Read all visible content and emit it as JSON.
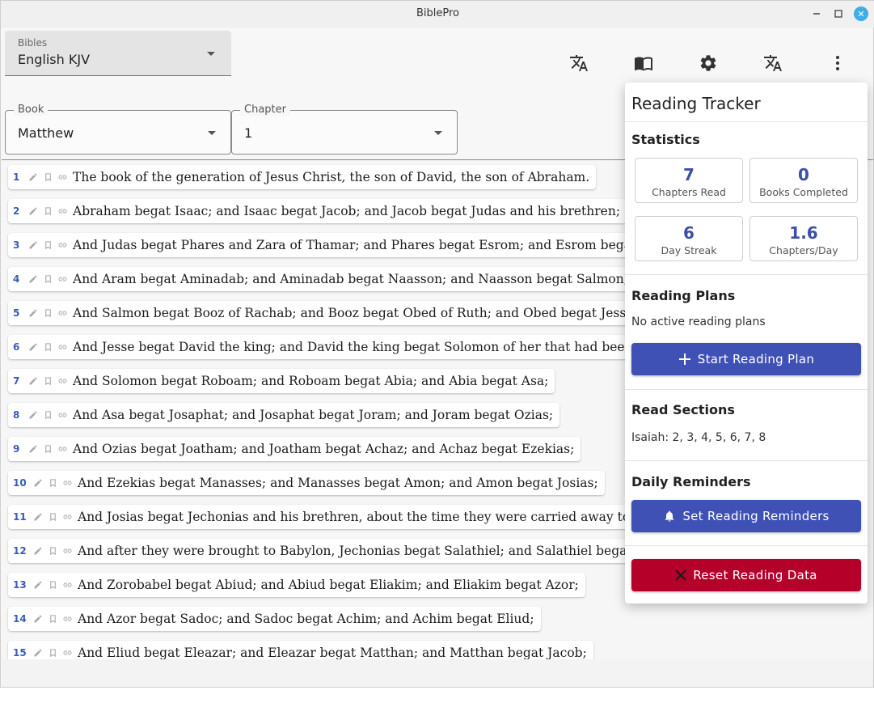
{
  "window": {
    "title": "BiblePro"
  },
  "bibles": {
    "label": "Bibles",
    "value": "English KJV"
  },
  "toolbar": {
    "icons": [
      "translate-icon",
      "book-open-icon",
      "settings-icon",
      "translate-icon",
      "more-vert-icon"
    ]
  },
  "book": {
    "label": "Book",
    "value": "Matthew"
  },
  "chapter": {
    "label": "Chapter",
    "value": "1"
  },
  "verses": [
    {
      "num": "1",
      "text": "The book of the generation of Jesus Christ, the son of David, the son of Abraham."
    },
    {
      "num": "2",
      "text": "Abraham begat Isaac; and Isaac begat Jacob; and Jacob begat Judas and his brethren;"
    },
    {
      "num": "3",
      "text": "And Judas begat Phares and Zara of Thamar; and Phares begat Esrom; and Esrom begat A"
    },
    {
      "num": "4",
      "text": "And Aram begat Aminadab; and Aminadab begat Naasson; and Naasson begat Salmon;"
    },
    {
      "num": "5",
      "text": "And Salmon begat Booz of Rachab; and Booz begat Obed of Ruth; and Obed begat Jesse;"
    },
    {
      "num": "6",
      "text": "And Jesse begat David the king; and David the king begat Solomon of her that had been th"
    },
    {
      "num": "7",
      "text": "And Solomon begat Roboam; and Roboam begat Abia; and Abia begat Asa;"
    },
    {
      "num": "8",
      "text": "And Asa begat Josaphat; and Josaphat begat Joram; and Joram begat Ozias;"
    },
    {
      "num": "9",
      "text": "And Ozias begat Joatham; and Joatham begat Achaz; and Achaz begat Ezekias;"
    },
    {
      "num": "10",
      "text": "And Ezekias begat Manasses; and Manasses begat Amon; and Amon begat Josias;"
    },
    {
      "num": "11",
      "text": "And Josias begat Jechonias and his brethren, about the time they were carried away to Ba"
    },
    {
      "num": "12",
      "text": "And after they were brought to Babylon, Jechonias begat Salathiel; and Salathiel begat Zo"
    },
    {
      "num": "13",
      "text": "And Zorobabel begat Abiud; and Abiud begat Eliakim; and Eliakim begat Azor;"
    },
    {
      "num": "14",
      "text": "And Azor begat Sadoc; and Sadoc begat Achim; and Achim begat Eliud;"
    },
    {
      "num": "15",
      "text": "And Eliud begat Eleazar; and Eleazar begat Matthan; and Matthan begat Jacob;"
    }
  ],
  "tracker": {
    "title": "Reading Tracker",
    "statistics": {
      "title": "Statistics",
      "chapters_read": {
        "value": "7",
        "label": "Chapters Read"
      },
      "books_completed": {
        "value": "0",
        "label": "Books Completed"
      },
      "day_streak": {
        "value": "6",
        "label": "Day Streak"
      },
      "chapters_per_day": {
        "value": "1.6",
        "label": "Chapters/Day"
      }
    },
    "plans": {
      "title": "Reading Plans",
      "empty": "No active reading plans",
      "button": "Start Reading Plan"
    },
    "read_sections": {
      "title": "Read Sections",
      "text": "Isaiah: 2, 3, 4, 5, 6, 7, 8"
    },
    "reminders": {
      "title": "Daily Reminders",
      "button": "Set Reading Reminders"
    },
    "reset": {
      "button": "Reset Reading Data"
    }
  },
  "colors": {
    "accent": "#3f51b5",
    "danger": "#b5002a",
    "verse_number": "#3b5bb8"
  }
}
